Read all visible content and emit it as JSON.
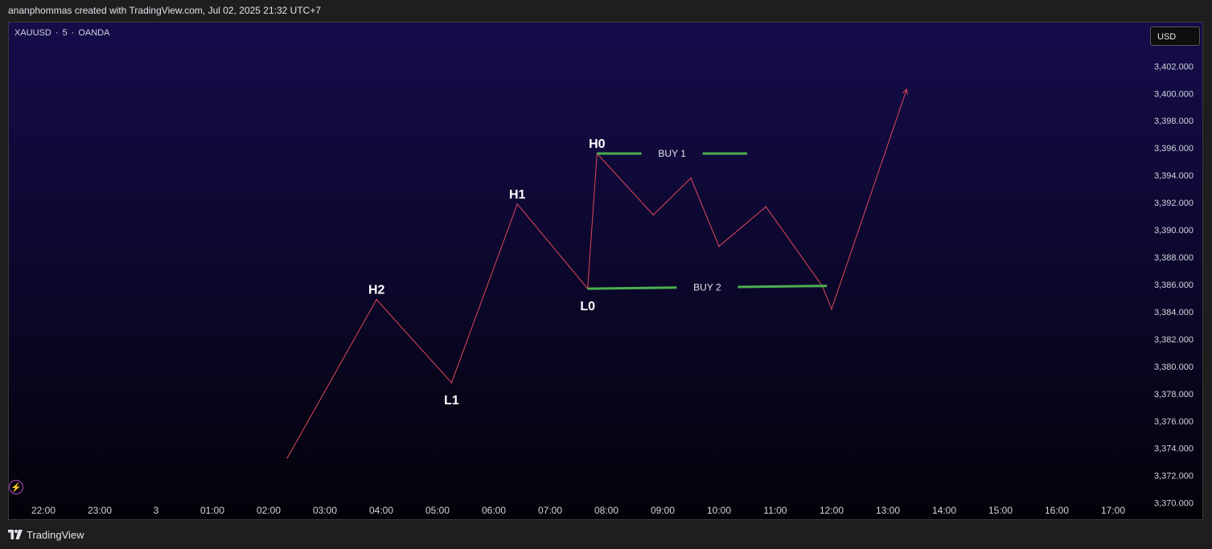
{
  "header": {
    "credit": "ananphommas created with TradingView.com, Jul 02, 2025 21:32 UTC+7"
  },
  "chart_header": {
    "symbol": "XAUUSD",
    "interval": "5",
    "broker": "OANDA",
    "separator": "·",
    "currency_button": "USD"
  },
  "footer": {
    "brand": "TradingView"
  },
  "colors": {
    "line": "#e0475a",
    "buy_line": "#4caf50",
    "background_top": "#150d4b",
    "background_bottom": "#030208"
  },
  "icons": {
    "flash": "lightning-icon",
    "logo": "tradingview-logo-icon"
  },
  "chart_data": {
    "type": "line",
    "x_ticks": [
      "22:00",
      "23:00",
      "3",
      "01:00",
      "02:00",
      "03:00",
      "04:00",
      "05:00",
      "06:00",
      "07:00",
      "08:00",
      "09:00",
      "10:00",
      "11:00",
      "12:00",
      "13:00",
      "14:00",
      "15:00",
      "16:00",
      "17:00"
    ],
    "y_ticks": [
      "3,402.000",
      "3,400.000",
      "3,398.000",
      "3,396.000",
      "3,394.000",
      "3,392.000",
      "3,390.000",
      "3,388.000",
      "3,386.000",
      "3,384.000",
      "3,382.000",
      "3,380.000",
      "3,378.000",
      "3,376.000",
      "3,374.000",
      "3,372.000",
      "3,370.000"
    ],
    "ylim": [
      3368.8,
      3405.2
    ],
    "series": [
      {
        "x": [
          "02:20",
          "03:55",
          "05:15",
          "06:25",
          "07:40",
          "07:50",
          "08:50",
          "09:30",
          "10:00",
          "10:50",
          "11:50",
          "12:00",
          "13:20"
        ],
        "y": [
          3373.3,
          3384.9,
          3378.8,
          3391.9,
          3385.7,
          3395.6,
          3391.1,
          3393.8,
          3388.8,
          3391.7,
          3385.9,
          3384.2,
          3400.3
        ]
      }
    ],
    "pivots": [
      {
        "label": "H2",
        "x": "03:55",
        "y": 3384.9,
        "pos": "above"
      },
      {
        "label": "L1",
        "x": "05:15",
        "y": 3378.8,
        "pos": "below"
      },
      {
        "label": "H1",
        "x": "06:25",
        "y": 3391.9,
        "pos": "above"
      },
      {
        "label": "L0",
        "x": "07:40",
        "y": 3385.7,
        "pos": "below"
      },
      {
        "label": "H0",
        "x": "07:50",
        "y": 3395.6,
        "pos": "above"
      }
    ],
    "levels": [
      {
        "label": "BUY 1",
        "x1": "07:50",
        "x2": "10:30",
        "y1": 3395.6,
        "y2": 3395.6
      },
      {
        "label": "BUY 2",
        "x1": "07:40",
        "x2": "11:55",
        "y1": 3385.7,
        "y2": 3385.9
      }
    ],
    "arrow_end": true,
    "grid": false
  }
}
